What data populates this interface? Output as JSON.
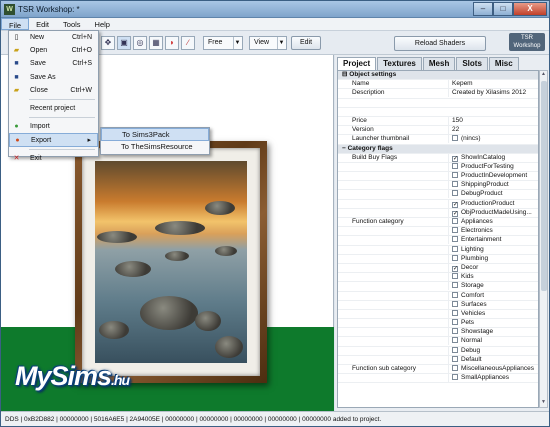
{
  "window": {
    "title": "TSR Workshop: *",
    "app_icon": "W",
    "min": "–",
    "max": "□",
    "close": "X"
  },
  "menubar": [
    "File",
    "Edit",
    "Tools",
    "Help"
  ],
  "toolbar": {
    "mode_select": "Free",
    "view_select": "View",
    "edit_button": "Edit",
    "reload_button": "Reload Shaders",
    "logo_line1": "TSR",
    "logo_line2": "Workshop"
  },
  "file_menu": [
    {
      "label": "New",
      "shortcut": "Ctrl+N",
      "icon": "new-icon"
    },
    {
      "label": "Open",
      "shortcut": "Ctrl+O",
      "icon": "open-icon"
    },
    {
      "label": "Save",
      "shortcut": "Ctrl+S",
      "icon": "save-icon"
    },
    {
      "label": "Save As",
      "shortcut": "",
      "icon": "save-as-icon"
    },
    {
      "label": "Close",
      "shortcut": "Ctrl+W",
      "icon": "close-doc-icon"
    },
    {
      "label": "Recent project",
      "shortcut": "",
      "icon": ""
    },
    {
      "label": "Import",
      "shortcut": "",
      "icon": "import-icon"
    },
    {
      "label": "Export",
      "shortcut": "",
      "icon": "export-icon"
    },
    {
      "label": "Exit",
      "shortcut": "",
      "icon": "exit-icon"
    }
  ],
  "export_submenu": [
    "To Sims3Pack",
    "To TheSimsResource"
  ],
  "tabs": [
    "Project",
    "Textures",
    "Mesh",
    "Slots",
    "Misc"
  ],
  "properties": {
    "section": "Object settings",
    "name_label": "Name",
    "name_value": "Kepem",
    "description_label": "Description",
    "description_value": "Created by Xilasims 2012",
    "price_label": "Price",
    "price_value": "150",
    "version_label": "Version",
    "version_value": "22",
    "thumb_label": "Launcher thumbnail",
    "thumb_value": "(nincs)",
    "category_flags": "Category flags",
    "build_buy_label": "Build Buy Flags",
    "build_buy": [
      {
        "label": "ShowInCatalog",
        "checked": true
      },
      {
        "label": "ProductForTesting",
        "checked": false
      },
      {
        "label": "ProductInDevelopment",
        "checked": false
      },
      {
        "label": "ShippingProduct",
        "checked": false
      },
      {
        "label": "DebugProduct",
        "checked": false
      },
      {
        "label": "ProductionProduct",
        "checked": true
      },
      {
        "label": "ObjProductMadeUsing...",
        "checked": true
      }
    ],
    "function_category_label": "Function category",
    "function_category": [
      {
        "label": "Appliances",
        "checked": false
      },
      {
        "label": "Electronics",
        "checked": false
      },
      {
        "label": "Entertainment",
        "checked": false
      },
      {
        "label": "Lighting",
        "checked": false
      },
      {
        "label": "Plumbing",
        "checked": false
      },
      {
        "label": "Decor",
        "checked": true
      },
      {
        "label": "Kids",
        "checked": false
      },
      {
        "label": "Storage",
        "checked": false
      },
      {
        "label": "Comfort",
        "checked": false
      },
      {
        "label": "Surfaces",
        "checked": false
      },
      {
        "label": "Vehicles",
        "checked": false
      },
      {
        "label": "Pets",
        "checked": false
      },
      {
        "label": "Showstage",
        "checked": false
      },
      {
        "label": "Normal",
        "checked": false
      },
      {
        "label": "Debug",
        "checked": false
      },
      {
        "label": "Default",
        "checked": false
      }
    ],
    "function_sub_label": "Function sub category",
    "function_sub": [
      {
        "label": "MiscellaneousAppliances",
        "checked": false
      },
      {
        "label": "SmallAppliances",
        "checked": false
      }
    ]
  },
  "status": "DDS | 0xB2D882 | 00000000 | 5016A6E5 | 2A94005E | 00000000 | 00000000 | 00000000 | 00000000 | 00000000 added to project.",
  "watermark": {
    "main": "MySims",
    "suffix": ".hu"
  },
  "colors": {
    "accent": "#0e7a2c",
    "highlight": "#cfe0f3"
  }
}
